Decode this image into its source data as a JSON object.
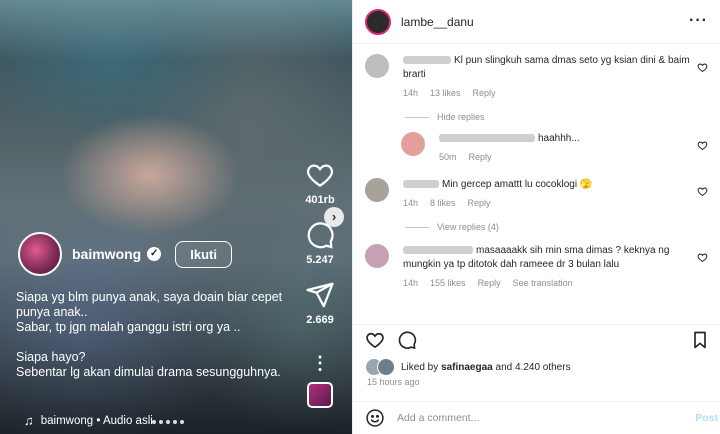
{
  "reel": {
    "author": "baimwong",
    "follow_label": "Ikuti",
    "caption_lines": [
      "Siapa yg blm punya anak, saya doain biar cepet punya anak..",
      "Sabar, tp jgn malah ganggu istri org ya ..",
      "Siapa hayo?",
      "Sebentar lg akan dimulai drama sesungguhnya."
    ],
    "audio_label": "baimwong • Audio asli",
    "likes": "401rb",
    "comments": "5.247",
    "shares": "2.669",
    "icons": [
      "heart-icon",
      "comment-icon",
      "share-icon",
      "more-icon",
      "music-note-icon",
      "chevron-right-icon"
    ]
  },
  "panel": {
    "username": "lambe__danu",
    "more_label": "···",
    "comments": [
      {
        "text": "Kl pun slingkuh sama dmas seto yg ksian dini & baim brarti",
        "time": "14h",
        "likes": "13 likes",
        "reply": "Reply"
      },
      {
        "toggle": "Hide replies"
      },
      {
        "text": "haahhh...",
        "time": "50m",
        "reply": "Reply"
      },
      {
        "text": "Min gercep amattt lu cocoklogi 🫣",
        "time": "14h",
        "likes": "8 likes",
        "reply": "Reply"
      },
      {
        "toggle": "View replies (4)"
      },
      {
        "text": "masaaaakk sih min sma dimas ? keknya ng mungkin ya tp ditotok dah rameee dr 3 bulan lalu",
        "time": "14h",
        "likes": "155 likes",
        "reply": "Reply",
        "translation": "See translation"
      }
    ],
    "liked_by_prefix": "Liked by ",
    "liked_by_user": "safinaegaa",
    "liked_by_suffix": " and 4.240 others",
    "timeago": "15 hours ago",
    "add_comment_placeholder": "Add a comment...",
    "post_label": "Post"
  }
}
